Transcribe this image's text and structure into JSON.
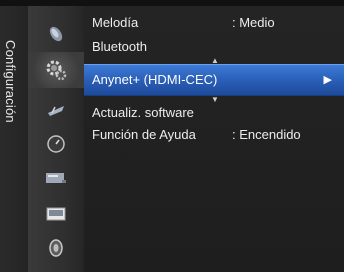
{
  "section": {
    "title": "Configuración"
  },
  "menu": {
    "items": [
      {
        "label": "Melodía",
        "value": ": Medio"
      },
      {
        "label": "Bluetooth",
        "value": ""
      },
      {
        "label": "Anynet+ (HDMI-CEC)",
        "value": "",
        "selected": true
      },
      {
        "label": "Actualiz. software",
        "value": ""
      },
      {
        "label": "Función de Ayuda",
        "value": ": Encendido"
      }
    ]
  },
  "icons": [
    "picture-icon",
    "settings-gear-icon",
    "channel-antenna-icon",
    "clock-icon",
    "input-source-icon",
    "application-icon",
    "support-icon"
  ],
  "accent_color": "#2a5fb8"
}
